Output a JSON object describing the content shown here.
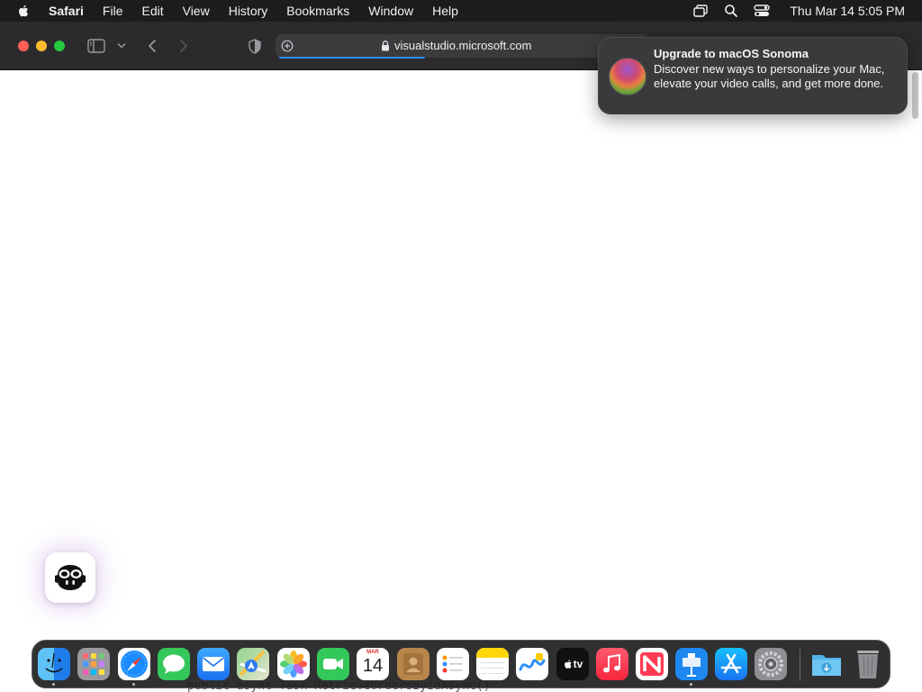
{
  "menubar": {
    "app_name": "Safari",
    "items": [
      "File",
      "Edit",
      "View",
      "History",
      "Bookmarks",
      "Window",
      "Help"
    ],
    "clock": "Thu Mar 14  5:05 PM",
    "status_icons": [
      "screen-mirroring-icon",
      "spotlight-search-icon",
      "control-center-icon"
    ]
  },
  "toolbar": {
    "url": "visualstudio.microsoft.com",
    "load_progress": 0.4
  },
  "notification": {
    "title": "Upgrade to macOS Sonoma",
    "body": "Discover new ways to personalize your Mac, elevate your video calls, and get more done."
  },
  "page": {
    "code_fragment": "public async Task RetrieveOrdersByIdAsync()"
  },
  "dock": {
    "calendar_month": "MAR",
    "calendar_day": "14",
    "tv_label": "tv",
    "apps": [
      "Finder",
      "Launchpad",
      "Safari",
      "Messages",
      "Mail",
      "Maps",
      "Photos",
      "FaceTime",
      "Calendar",
      "Contacts",
      "Reminders",
      "Notes",
      "Freeform",
      "TV",
      "Music",
      "News",
      "Keynote",
      "App Store",
      "System Settings",
      "Downloads",
      "Trash"
    ]
  },
  "colors": {
    "menubar_bg": "#1c1c1e",
    "toolbar_bg": "#2b2b2d",
    "accent": "#2e8fff",
    "close": "#ff5f57",
    "minimize": "#febc2e",
    "zoom": "#28c840"
  }
}
